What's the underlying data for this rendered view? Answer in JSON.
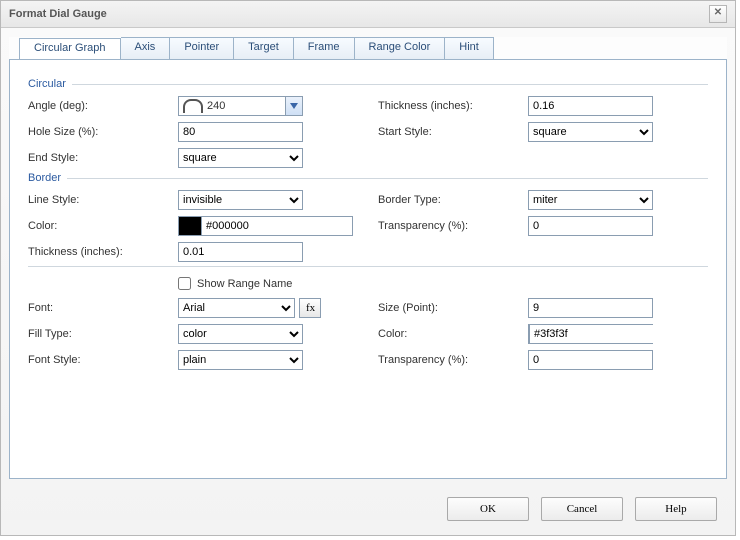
{
  "title": "Format Dial Gauge",
  "tabs": [
    "Circular Graph",
    "Axis",
    "Pointer",
    "Target",
    "Frame",
    "Range Color",
    "Hint"
  ],
  "active_tab": 0,
  "sections": {
    "circular": "Circular",
    "border": "Border"
  },
  "labels": {
    "angle": "Angle (deg):",
    "thickness_in": "Thickness (inches):",
    "hole": "Hole Size (%):",
    "start_style": "Start Style:",
    "end_style": "End Style:",
    "line_style": "Line Style:",
    "border_type": "Border Type:",
    "color": "Color:",
    "transparency": "Transparency (%):",
    "show_range": "Show Range Name",
    "font": "Font:",
    "size_pt": "Size (Point):",
    "fill_type": "Fill Type:",
    "font_style": "Font Style:",
    "fx": "fx"
  },
  "values": {
    "angle": "240",
    "thickness_in": "0.16",
    "hole": "80",
    "start_style": "square",
    "end_style": "square",
    "line_style": "invisible",
    "border_type": "miter",
    "color_hex": "#000000",
    "transparency": "0",
    "border_thickness": "0.01",
    "show_range": false,
    "font": "Arial",
    "size_pt": "9",
    "fill_type": "color",
    "text_color": "#3f3f3f",
    "font_style": "plain",
    "text_transparency": "0"
  },
  "buttons": {
    "ok": "OK",
    "cancel": "Cancel",
    "help": "Help"
  }
}
